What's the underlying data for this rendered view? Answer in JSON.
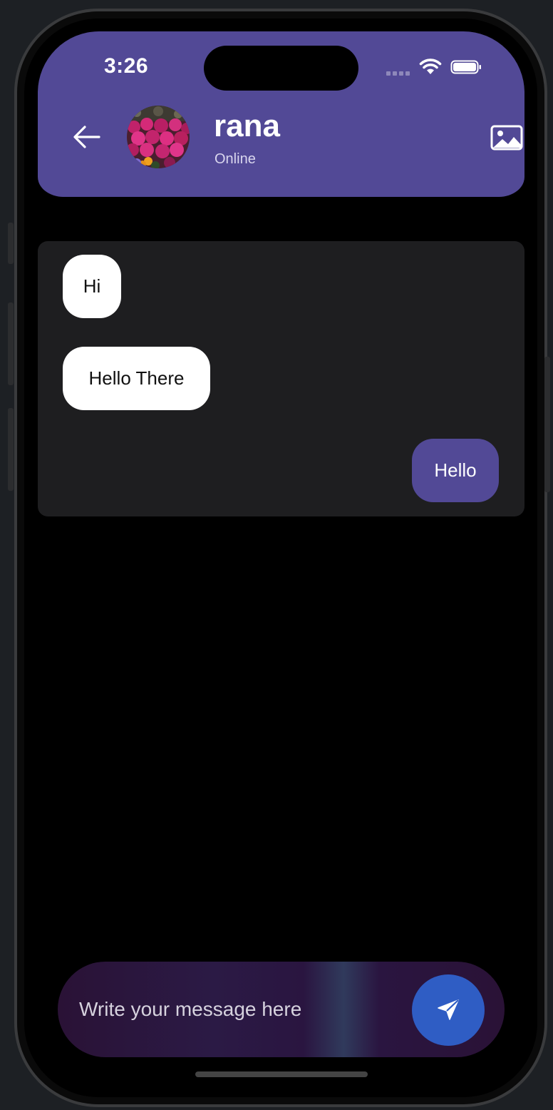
{
  "status_bar": {
    "time": "3:26"
  },
  "header": {
    "back_icon": "arrow-left-icon",
    "contact_name": "rana",
    "contact_status": "Online",
    "media_icon": "image-icon"
  },
  "messages": [
    {
      "text": "Hi",
      "direction": "incoming"
    },
    {
      "text": "Hello There",
      "direction": "incoming"
    },
    {
      "text": "Hello",
      "direction": "outgoing"
    }
  ],
  "composer": {
    "placeholder": "Write your message here",
    "send_icon": "send-icon"
  },
  "colors": {
    "accent": "#524996",
    "send_button": "#2f5dc4",
    "incoming_bubble": "#ffffff",
    "chat_background": "#1e1e20"
  }
}
